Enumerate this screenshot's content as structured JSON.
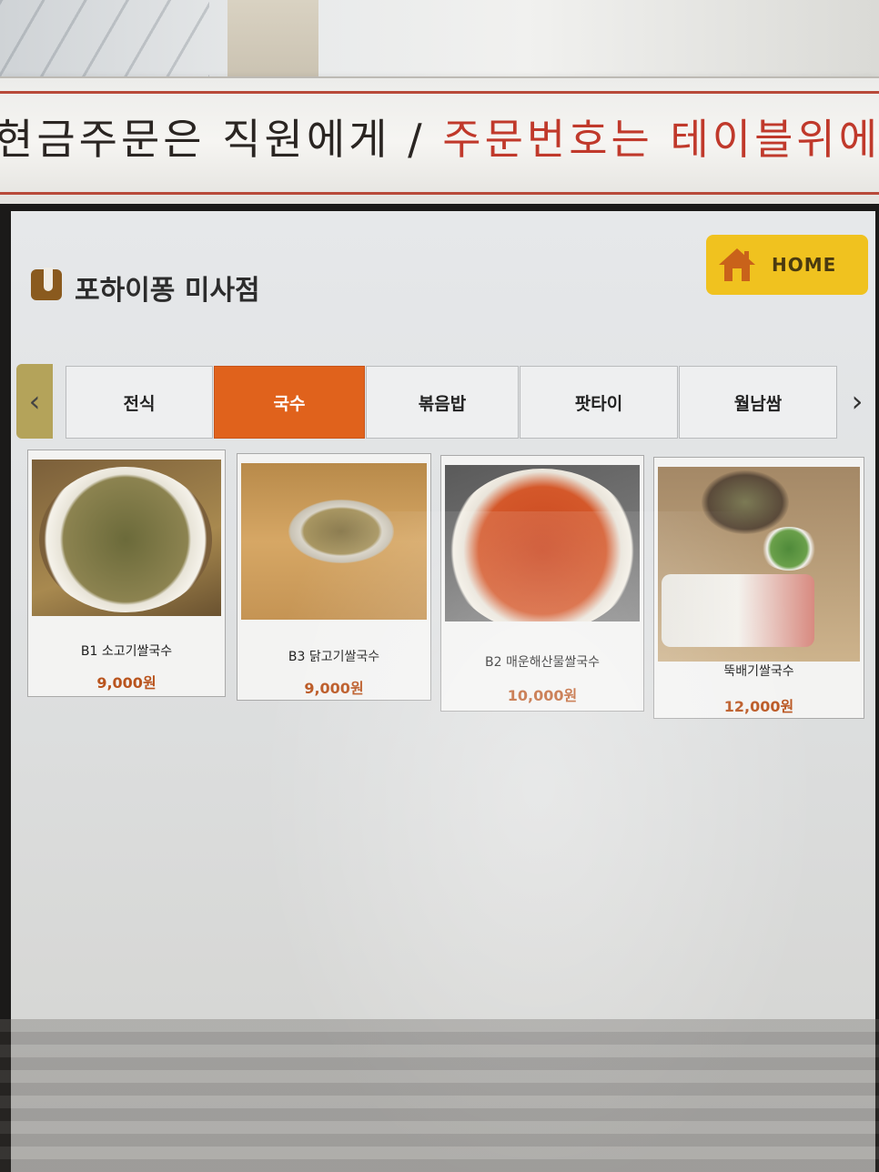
{
  "sign": {
    "black_text": "현금주문은 직원에게 / ",
    "red_text": "주문번호는 테이블위에"
  },
  "header": {
    "store_name": "포하이퐁 미사점",
    "home_label": "HOME"
  },
  "tabs": [
    {
      "label": "전식",
      "active": false
    },
    {
      "label": "국수",
      "active": true
    },
    {
      "label": "볶음밥",
      "active": false
    },
    {
      "label": "팟타이",
      "active": false
    },
    {
      "label": "월남쌈",
      "active": false
    }
  ],
  "nav": {
    "prev": "‹",
    "next": "›"
  },
  "menu_items": [
    {
      "name": "B1 소고기쌀국수",
      "price": "9,000원"
    },
    {
      "name": "B3 닭고기쌀국수",
      "price": "9,000원"
    },
    {
      "name": "B2 매운해산물쌀국수",
      "price": "10,000원"
    },
    {
      "name": "뚝배기쌀국수",
      "price": "12,000원"
    }
  ],
  "colors": {
    "active_tab": "#e0621c",
    "home_button": "#f0c21f",
    "price": "#b9541e",
    "sign_red": "#c0392b"
  }
}
